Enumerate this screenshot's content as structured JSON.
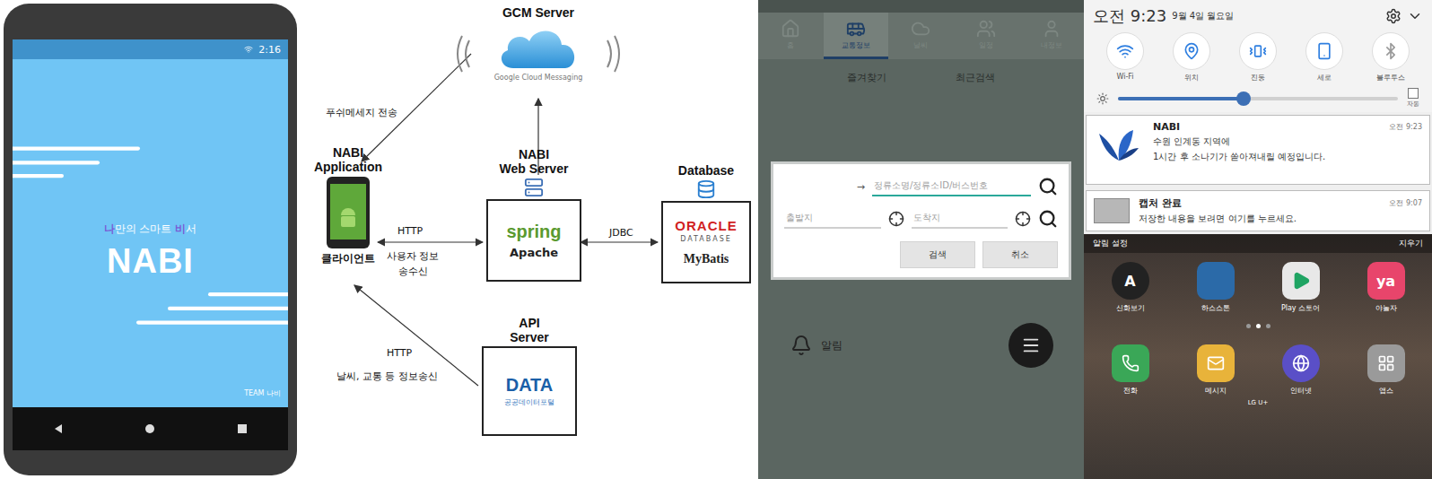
{
  "splash": {
    "status_time": "2:16",
    "tagline": [
      {
        "text": "나",
        "highlight": true
      },
      {
        "text": "만의 스마트 ",
        "highlight": false
      },
      {
        "text": "비",
        "highlight": true
      },
      {
        "text": "서",
        "highlight": false
      }
    ],
    "title": "NABI",
    "team": "TEAM 나비"
  },
  "diagram": {
    "gcm": {
      "title": "GCM Server",
      "logo_text": "Google Cloud Messaging"
    },
    "app": {
      "title": [
        "NABI",
        "Application"
      ],
      "caption": "클라이언트"
    },
    "web": {
      "title": [
        "NABI",
        "Web Server"
      ],
      "logos": [
        "spring",
        "Apache"
      ]
    },
    "db": {
      "title": "Database",
      "logos": [
        "ORACLE",
        "DATABASE",
        "MyBatis"
      ]
    },
    "api": {
      "title": [
        "API",
        "Server"
      ],
      "logo": "DATA",
      "logo_sub": "공공데이터포털"
    },
    "edges": [
      {
        "lines": [
          "푸쉬메세지 전송"
        ]
      },
      {
        "lines": [
          "HTTP"
        ]
      },
      {
        "lines": [
          "사용자 정보",
          "송수신"
        ]
      },
      {
        "lines": [
          "JDBC"
        ]
      },
      {
        "lines": [
          "HTTP"
        ]
      },
      {
        "lines": [
          "날씨, 교통 등 정보송신"
        ]
      }
    ]
  },
  "app_screen": {
    "tabs": [
      {
        "label": "홈",
        "selected": false
      },
      {
        "label": "교통정보",
        "selected": true
      },
      {
        "label": "날씨",
        "selected": false
      },
      {
        "label": "일정",
        "selected": false
      },
      {
        "label": "내정보",
        "selected": false
      }
    ],
    "sub_tabs": [
      "즐겨찾기",
      "최근검색"
    ],
    "dialog": {
      "arrow": "→",
      "search_placeholder": "정류소명/정류소ID/버스번호",
      "from_placeholder": "출발지",
      "to_placeholder": "도착지",
      "buttons": [
        "검색",
        "취소"
      ]
    },
    "alarm_label": "알림"
  },
  "shade": {
    "time": "오전 9:23",
    "date": "9월 4일 월요일",
    "toggles": [
      {
        "label": "Wi-Fi",
        "on": true
      },
      {
        "label": "위치",
        "on": true
      },
      {
        "label": "진동",
        "on": true
      },
      {
        "label": "세로",
        "on": true
      },
      {
        "label": "블루투스",
        "on": false
      }
    ],
    "brightness": {
      "level": 0.45,
      "auto_label": "자동"
    },
    "notifications": [
      {
        "kind": "app",
        "title": "NABI",
        "time": "오전 9:23",
        "lines": [
          "수원 인계동 지역에",
          "1시간 후 소나기가 쏟아져내릴 예정입니다."
        ]
      },
      {
        "kind": "capture",
        "title": "캡처 완료",
        "time": "오전 9:07",
        "lines": [
          "저장한 내용을 보려면 여기를 누르세요."
        ]
      }
    ],
    "settings_label": "알림 설정",
    "clear_label": "지우기",
    "apps": [
      {
        "glyph": "A",
        "label": "신화보기"
      },
      {
        "glyph": "",
        "label": "하스스톤"
      },
      {
        "glyph": "",
        "label": "Play 스토어"
      },
      {
        "glyph": "ya",
        "label": "야놀자"
      }
    ],
    "dock": [
      "전화",
      "메시지",
      "인터넷",
      "앱스"
    ],
    "carrier": "LG U+"
  }
}
